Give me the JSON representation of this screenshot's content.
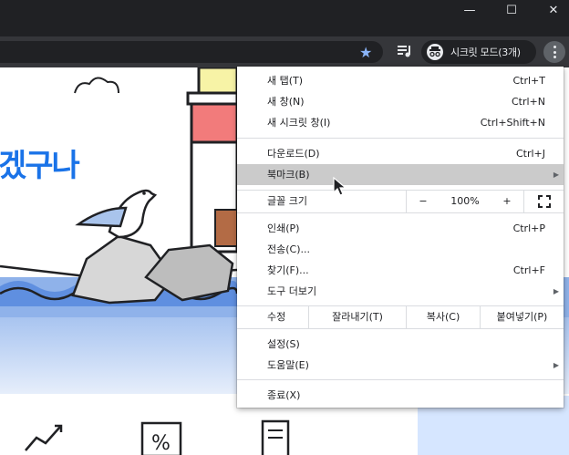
{
  "window": {
    "minimize_glyph": "—",
    "maximize_glyph": "☐",
    "close_glyph": "✕"
  },
  "toolbar": {
    "incognito_label": "시크릿 모드(3개)",
    "star_icon": "star-icon",
    "accent": "#8ab4f8"
  },
  "page": {
    "hero_title": "겠구나"
  },
  "menu": {
    "new_tab": {
      "label": "새 탭(T)",
      "shortcut": "Ctrl+T"
    },
    "new_window": {
      "label": "새 창(N)",
      "shortcut": "Ctrl+N"
    },
    "new_incognito": {
      "label": "새 시크릿 창(I)",
      "shortcut": "Ctrl+Shift+N"
    },
    "downloads": {
      "label": "다운로드(D)",
      "shortcut": "Ctrl+J"
    },
    "bookmarks": {
      "label": "북마크(B)"
    },
    "zoom": {
      "label": "글꼴 크기",
      "minus": "−",
      "value": "100%",
      "plus": "+"
    },
    "print": {
      "label": "인쇄(P)",
      "shortcut": "Ctrl+P"
    },
    "cast": {
      "label": "전송(C)..."
    },
    "find": {
      "label": "찾기(F)...",
      "shortcut": "Ctrl+F"
    },
    "more_tools": {
      "label": "도구 더보기"
    },
    "edit": {
      "label": "수정",
      "cut": "잘라내기(T)",
      "copy": "복사(C)",
      "paste": "붙여넣기(P)"
    },
    "settings": {
      "label": "설정(S)"
    },
    "help": {
      "label": "도움말(E)"
    },
    "exit": {
      "label": "종료(X)"
    }
  }
}
